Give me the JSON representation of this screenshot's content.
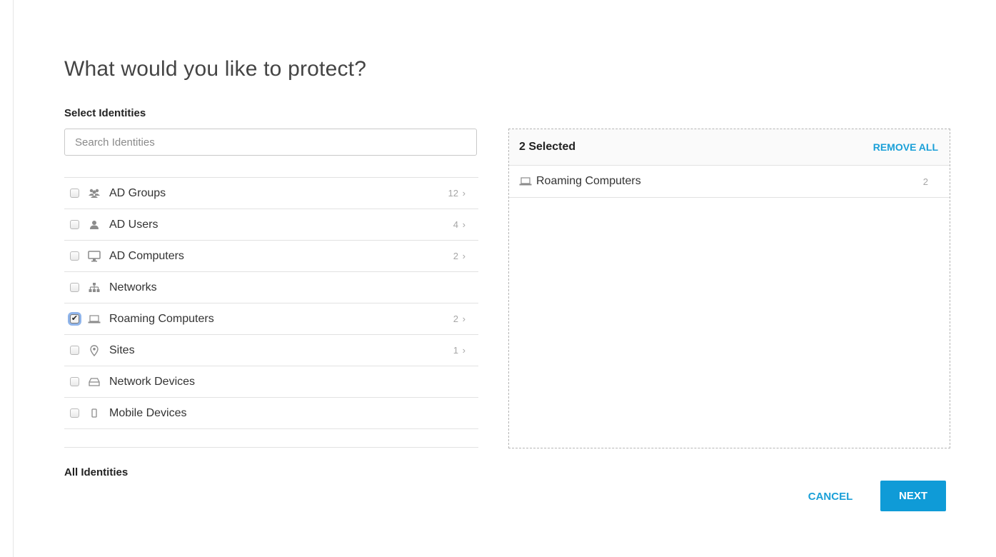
{
  "title": "What would you like to protect?",
  "select_label": "Select Identities",
  "search": {
    "placeholder": "Search Identities",
    "value": ""
  },
  "identities": [
    {
      "label": "AD Groups",
      "icon": "ad-groups-icon",
      "count": "12",
      "checked": false
    },
    {
      "label": "AD Users",
      "icon": "ad-users-icon",
      "count": "4",
      "checked": false
    },
    {
      "label": "AD Computers",
      "icon": "ad-computers-icon",
      "count": "2",
      "checked": false
    },
    {
      "label": "Networks",
      "icon": "networks-icon",
      "count": "",
      "checked": false
    },
    {
      "label": "Roaming Computers",
      "icon": "roaming-computers-icon",
      "count": "2",
      "checked": true
    },
    {
      "label": "Sites",
      "icon": "sites-icon",
      "count": "1",
      "checked": false
    },
    {
      "label": "Network Devices",
      "icon": "network-devices-icon",
      "count": "",
      "checked": false
    },
    {
      "label": "Mobile Devices",
      "icon": "mobile-devices-icon",
      "count": "",
      "checked": false
    }
  ],
  "all_identities_label": "All Identities",
  "selected_panel": {
    "count_label": "2 Selected",
    "remove_all_label": "REMOVE ALL",
    "items": [
      {
        "label": "Roaming Computers",
        "icon": "roaming-computers-icon",
        "count": "2"
      }
    ]
  },
  "buttons": {
    "cancel": "CANCEL",
    "next": "NEXT"
  },
  "colors": {
    "accent": "#1ba0d8",
    "next_bg": "#0f9bd7",
    "focus_ring": "#8fb4ea"
  }
}
